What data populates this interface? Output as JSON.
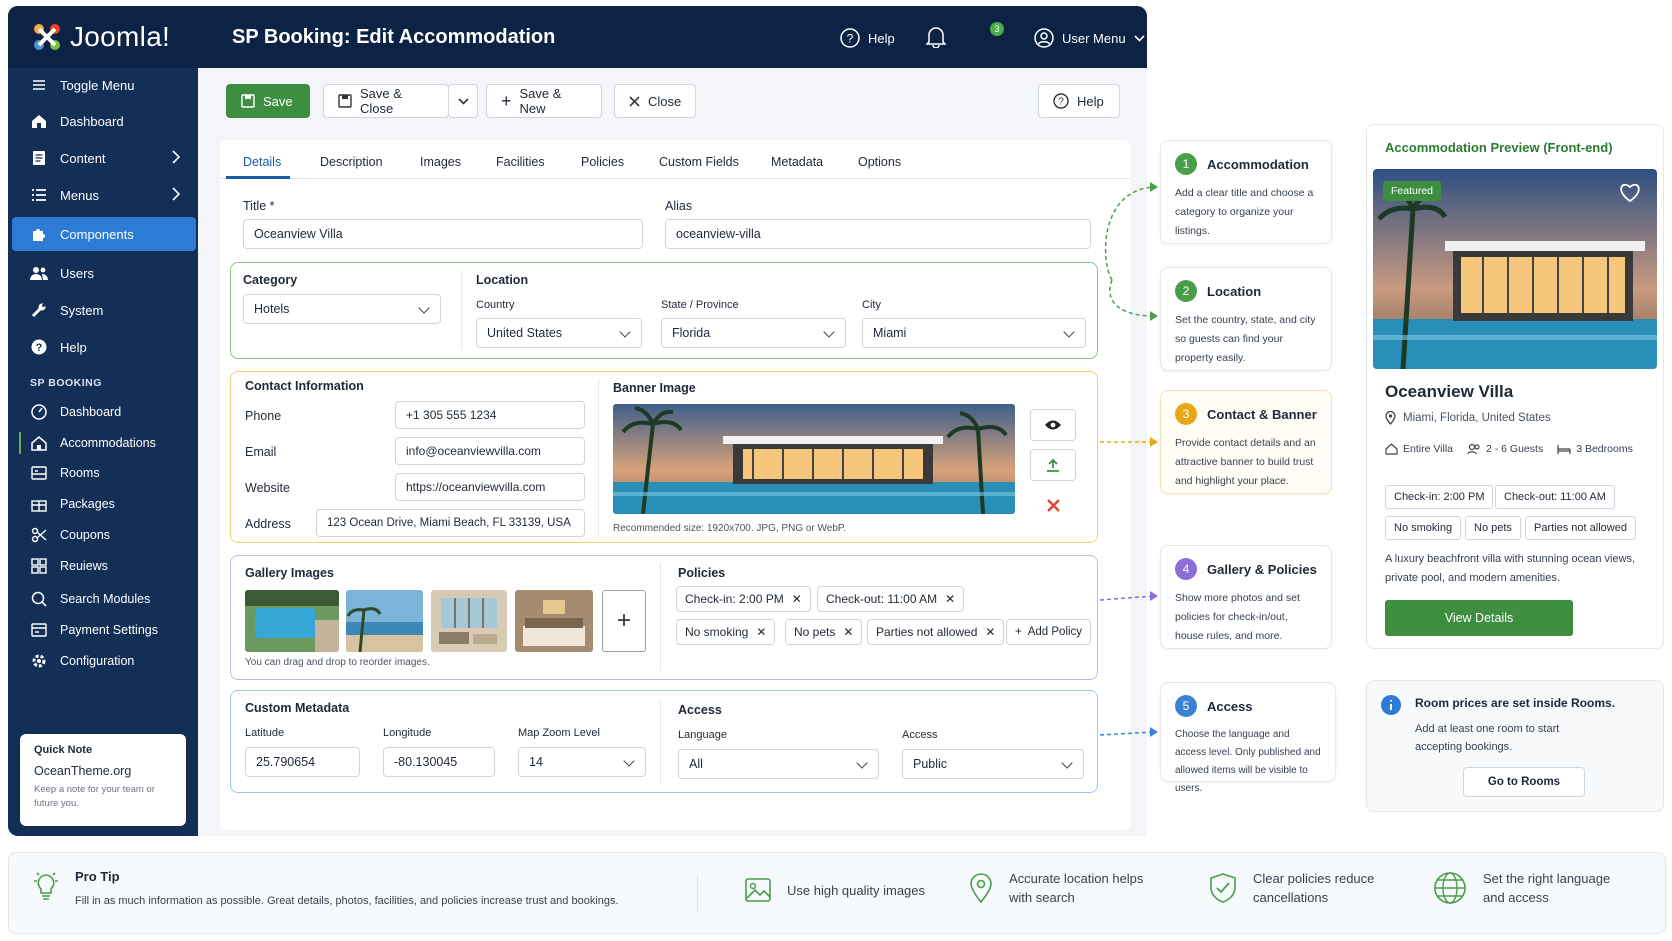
{
  "app": {
    "logo_text": "Joomla!",
    "page_title": "SP Booking: Edit Accommodation"
  },
  "header": {
    "help_label": "Help",
    "notifications_count": "3",
    "user_menu_label": "User Menu"
  },
  "sidebar": {
    "main_items": [
      {
        "label": "Toggle Menu",
        "icon": "toggle-icon"
      },
      {
        "label": "Dashboard",
        "icon": "home-icon"
      },
      {
        "label": "Content",
        "icon": "file-icon"
      },
      {
        "label": "Menus",
        "icon": "list-icon"
      },
      {
        "label": "Components",
        "icon": "puzzle-icon"
      },
      {
        "label": "Users",
        "icon": "users-icon"
      },
      {
        "label": "System",
        "icon": "wrench-icon"
      },
      {
        "label": "Help",
        "icon": "help-icon"
      }
    ],
    "section_title": "SP BOOKING",
    "sp_items": [
      {
        "label": "Dashboard",
        "icon": "gauge-icon"
      },
      {
        "label": "Accommodations",
        "icon": "house-icon"
      },
      {
        "label": "Rooms",
        "icon": "bed-icon"
      },
      {
        "label": "Packages",
        "icon": "gift-icon"
      },
      {
        "label": "Coupons",
        "icon": "scissors-icon"
      },
      {
        "label": "Reuiews",
        "icon": "grid-icon"
      },
      {
        "label": "Search Modules",
        "icon": "search-icon"
      },
      {
        "label": "Payment Settings",
        "icon": "card-icon"
      },
      {
        "label": "Configuration",
        "icon": "gear-icon"
      }
    ],
    "quick_note": {
      "title": "Quick Note",
      "value": "OceanTheme.org",
      "hint": "Keep a note for your team or future you."
    }
  },
  "toolbar": {
    "save": "Save",
    "save_close": "Save & Close",
    "save_new": "Save & New",
    "close": "Close",
    "help": "Help"
  },
  "tabs": [
    "Details",
    "Description",
    "Images",
    "Facilities",
    "Policies",
    "Custom Fields",
    "Metadata",
    "Options"
  ],
  "form": {
    "title_label": "Title *",
    "title_value": "Oceanview Villa",
    "alias_label": "Alias",
    "alias_value": "oceanview-villa",
    "category_label": "Category",
    "category_value": "Hotels",
    "location_label": "Location",
    "country_label": "Country",
    "country_value": "United States",
    "state_label": "State / Province",
    "state_value": "Florida",
    "city_label": "City",
    "city_value": "Miami",
    "contact_title": "Contact Information",
    "phone_label": "Phone",
    "phone_value": "+1 305 555 1234",
    "email_label": "Email",
    "email_value": "info@oceanviewvilla.com",
    "website_label": "Website",
    "website_value": "https://oceanviewvilla.com",
    "address_label": "Address",
    "address_value": "123 Ocean Drive, Miami Beach, FL 33139, USA",
    "banner_title": "Banner Image",
    "banner_hint": "Recommended size: 1920x700. JPG, PNG or WebP.",
    "gallery_title": "Gallery Images",
    "gallery_hint": "You can drag and drop to reorder images.",
    "policies_title": "Policies",
    "policies": [
      "Check-in: 2:00 PM",
      "Check-out: 11:00 AM",
      "No smoking",
      "No pets",
      "Parties not allowed"
    ],
    "add_policy": "Add Policy",
    "metadata_title": "Custom Metadata",
    "latitude_label": "Latitude",
    "latitude_value": "25.790654",
    "longitude_label": "Longitude",
    "longitude_value": "-80.130045",
    "zoom_label": "Map Zoom Level",
    "zoom_value": "14",
    "access_title": "Access",
    "language_label": "Language",
    "language_value": "All",
    "access_label": "Access",
    "access_value": "Public"
  },
  "guide": [
    {
      "num": "1",
      "title": "Accommodation",
      "text": "Add a clear title and choose a category to organize your listings.",
      "color": "#4a9e4a"
    },
    {
      "num": "2",
      "title": "Location",
      "text": "Set the country, state, and city so guests can find your property easily.",
      "color": "#4a9e4a"
    },
    {
      "num": "3",
      "title": "Contact & Banner",
      "text": "Provide contact details and an attractive banner to build trust and highlight your place.",
      "color": "#e6a817"
    },
    {
      "num": "4",
      "title": "Gallery & Policies",
      "text": "Show more photos and set policies for check-in/out, house rules, and more.",
      "color": "#8b6fd6"
    },
    {
      "num": "5",
      "title": "Access",
      "text": "Choose the language and access level. Only published and allowed items will be visible to users.",
      "color": "#3b82d6"
    }
  ],
  "preview": {
    "title": "Accommodation Preview (Front-end)",
    "badge": "Featured",
    "name": "Oceanview Villa",
    "location": "Miami, Florida, United States",
    "type": "Entire Villa",
    "guests": "2 - 6 Guests",
    "bedrooms": "3 Bedrooms",
    "chips": [
      "Check-in: 2:00 PM",
      "Check-out: 11:00 AM",
      "No smoking",
      "No pets",
      "Parties not allowed"
    ],
    "description": "A luxury beachfront villa with stunning ocean views, private pool, and modern amenities.",
    "cta": "View Details"
  },
  "info": {
    "title": "Room prices are set inside Rooms.",
    "text": "Add at least one room to start accepting bookings.",
    "button": "Go to Rooms"
  },
  "protip": {
    "title": "Pro Tip",
    "text": "Fill in as much information as possible. Great details, photos, facilities, and policies increase trust and bookings.",
    "tips": [
      "Use high quality images",
      "Accurate location helps with search",
      "Clear policies reduce cancellations",
      "Set the right language and access"
    ]
  },
  "colors": {
    "sidebar": "#132f55",
    "header": "#0c2345",
    "accent": "#2e7bd6",
    "green": "#3e8e41"
  }
}
